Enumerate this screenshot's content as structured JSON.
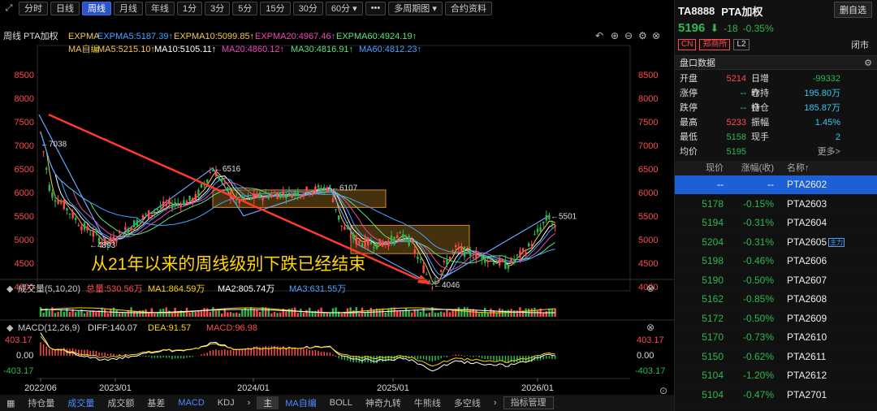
{
  "toolbar": {
    "buttons": [
      "分时",
      "日线",
      "周线",
      "月线",
      "年线",
      "1分",
      "3分",
      "5分",
      "15分",
      "30分",
      "60分 ▾",
      "•••",
      "多周期图 ▾",
      "合约资料"
    ],
    "active": "周线"
  },
  "chart": {
    "title": "周线 PTA加权",
    "expma_label": "EXPMA",
    "expma": [
      "EXPMA5:5187.39↑",
      "EXPMA10:5099.85↑",
      "EXPMA20:4967.46↑",
      "EXPMA60:4924.19↑"
    ],
    "ma_label": "MA自编",
    "ma": [
      "MA5:5215.10↑",
      "MA10:5105.11↑",
      "MA20:4860.12↑",
      "MA30:4816.91↑",
      "MA60:4812.23↑"
    ],
    "colors": {
      "ma5": "#f2c94c",
      "ma10": "#ffffff",
      "ma20": "#e84bb4",
      "ma30": "#5be37a",
      "ma60": "#4aa3ff",
      "expma5": "#4aa3ff",
      "expma10": "#f2c94c",
      "expma20": "#e84bb4",
      "expma60": "#5be37a"
    },
    "annotation": "从21年以来的周线级别下跌已经结束",
    "markers": [
      {
        "label": "7038",
        "value": 7038
      },
      {
        "label": "4893",
        "value": 4893
      },
      {
        "label": "6516",
        "value": 6516
      },
      {
        "label": "6107",
        "value": 6107
      },
      {
        "label": "4046",
        "value": 4046
      },
      {
        "label": "5501",
        "value": 5501
      }
    ],
    "volume": {
      "title": "成交量(5,10,20)",
      "total": "总量:530.56万",
      "ma1": "MA1:864.59万",
      "ma2": "MA2:805.74万",
      "ma3": "MA3:631.55万"
    },
    "macd": {
      "title": "MACD(12,26,9)",
      "diff": "DIFF:140.07",
      "dea": "DEA:91.57",
      "macd": "MACD:96.98",
      "ticks": [
        "403.17",
        "0.00",
        "-403.17"
      ]
    },
    "xticks": [
      "2022/06",
      "2023/01",
      "2024/01",
      "2025/01",
      "2026/01"
    ]
  },
  "chart_data": {
    "type": "candlestick",
    "title": "PTA加权 周线",
    "ylim": [
      3600,
      8600
    ],
    "yticks": [
      8500,
      8000,
      7500,
      7000,
      6500,
      6000,
      5500,
      5000,
      4500,
      4000
    ],
    "x": [
      "2022/06",
      "2022/10",
      "2023/01",
      "2023/04",
      "2023/08",
      "2023/11",
      "2024/01",
      "2024/04",
      "2024/07",
      "2024/10",
      "2025/01",
      "2025/04",
      "2025/07",
      "2025/10",
      "2026/01",
      "2026/02"
    ],
    "close_approx": [
      7038,
      6000,
      5300,
      4893,
      5700,
      6516,
      5900,
      6000,
      6107,
      5200,
      4950,
      4046,
      4800,
      4500,
      4700,
      5196
    ],
    "labeled_extrema": [
      {
        "point": "high",
        "value": 7038
      },
      {
        "point": "low",
        "value": 4893
      },
      {
        "point": "high",
        "value": 6516
      },
      {
        "point": "high",
        "value": 6107
      },
      {
        "point": "low",
        "value": 4046
      },
      {
        "point": "high",
        "value": 5501
      }
    ]
  },
  "bottombar": [
    "持仓量",
    "成交量",
    "成交额",
    "基差",
    "MACD",
    "KDJ",
    "›",
    "主",
    "MA自编",
    "BOLL",
    "神奇九转",
    "牛熊线",
    "多空线",
    "›",
    "指标管理"
  ],
  "panel": {
    "symbol": "TA8888",
    "name": "PTA加权",
    "watch_button": "删自选",
    "price": "5196",
    "change": "-18",
    "change_pct": "-0.35%",
    "tags": [
      "CN",
      "郑商所",
      "L2"
    ],
    "status": "闭市",
    "section": "盘口数据",
    "stats": [
      [
        "开盘",
        "5214",
        "日增仓",
        "-99332"
      ],
      [
        "涨停",
        "--",
        "昨持仓",
        "195.80万"
      ],
      [
        "跌停",
        "--",
        "持仓",
        "185.87万"
      ],
      [
        "最高",
        "5233",
        "振幅",
        "1.45%"
      ],
      [
        "最低",
        "5158",
        "现手",
        "2"
      ],
      [
        "均价",
        "5195",
        "",
        ""
      ]
    ],
    "more": "更多>",
    "table_headers": [
      "现价",
      "涨幅(收)",
      "名称↑"
    ],
    "rows": [
      [
        "--",
        "--",
        "PTA2602"
      ],
      [
        "5178",
        "-0.15%",
        "PTA2603"
      ],
      [
        "5194",
        "-0.31%",
        "PTA2604"
      ],
      [
        "5204",
        "-0.31%",
        "PTA2605"
      ],
      [
        "5198",
        "-0.46%",
        "PTA2606"
      ],
      [
        "5190",
        "-0.50%",
        "PTA2607"
      ],
      [
        "5162",
        "-0.85%",
        "PTA2608"
      ],
      [
        "5172",
        "-0.50%",
        "PTA2609"
      ],
      [
        "5170",
        "-0.73%",
        "PTA2610"
      ],
      [
        "5150",
        "-0.62%",
        "PTA2611"
      ],
      [
        "5104",
        "-1.20%",
        "PTA2612"
      ],
      [
        "5104",
        "-0.47%",
        "PTA2701"
      ]
    ],
    "main_badge": "主力"
  }
}
